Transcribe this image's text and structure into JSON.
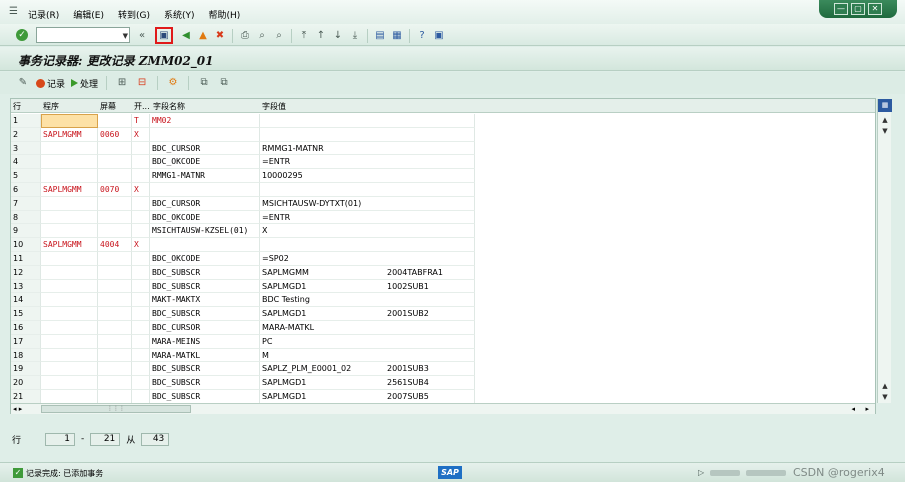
{
  "menu": {
    "items": [
      "记录(R)",
      "编辑(E)",
      "转到(G)",
      "系统(Y)",
      "帮助(H)"
    ]
  },
  "window_controls": [
    "—",
    "▢",
    "✕"
  ],
  "toolbar": {
    "command_field_value": "",
    "icons": [
      "enter-icon",
      "save-icon",
      "back-icon",
      "exit-icon",
      "cancel-icon",
      "print-icon",
      "find-icon",
      "find-next-icon",
      "first-page-icon",
      "prev-page-icon",
      "next-page-icon",
      "last-page-icon",
      "create-session-icon",
      "shortcut-icon",
      "help-icon",
      "layout-icon"
    ]
  },
  "title": "事务记录器: 更改记录 ZMM02_01",
  "app_toolbar": {
    "record_label": "记录",
    "process_label": "处理"
  },
  "table": {
    "headers": [
      "行",
      "程序",
      "屏幕",
      "开...",
      "字段名称",
      "字段值"
    ],
    "rows": [
      {
        "n": "1",
        "prog": "",
        "scr": "",
        "start": "T",
        "field": "MM02",
        "value": "",
        "extra": "",
        "field_red": true,
        "selected": true
      },
      {
        "n": "2",
        "prog": "SAPLMGMM",
        "scr": "0060",
        "start": "X",
        "field": "",
        "value": "",
        "extra": ""
      },
      {
        "n": "3",
        "prog": "",
        "scr": "",
        "start": "",
        "field": "BDC_CURSOR",
        "value": "RMMG1-MATNR",
        "extra": ""
      },
      {
        "n": "4",
        "prog": "",
        "scr": "",
        "start": "",
        "field": "BDC_OKCODE",
        "value": "=ENTR",
        "extra": ""
      },
      {
        "n": "5",
        "prog": "",
        "scr": "",
        "start": "",
        "field": "RMMG1-MATNR",
        "value": "10000295",
        "extra": ""
      },
      {
        "n": "6",
        "prog": "SAPLMGMM",
        "scr": "0070",
        "start": "X",
        "field": "",
        "value": "",
        "extra": ""
      },
      {
        "n": "7",
        "prog": "",
        "scr": "",
        "start": "",
        "field": "BDC_CURSOR",
        "value": "MSICHTAUSW-DYTXT(01)",
        "extra": ""
      },
      {
        "n": "8",
        "prog": "",
        "scr": "",
        "start": "",
        "field": "BDC_OKCODE",
        "value": "=ENTR",
        "extra": ""
      },
      {
        "n": "9",
        "prog": "",
        "scr": "",
        "start": "",
        "field": "MSICHTAUSW-KZSEL(01)",
        "value": "X",
        "extra": ""
      },
      {
        "n": "10",
        "prog": "SAPLMGMM",
        "scr": "4004",
        "start": "X",
        "field": "",
        "value": "",
        "extra": ""
      },
      {
        "n": "11",
        "prog": "",
        "scr": "",
        "start": "",
        "field": "BDC_OKCODE",
        "value": "=SP02",
        "extra": ""
      },
      {
        "n": "12",
        "prog": "",
        "scr": "",
        "start": "",
        "field": "BDC_SUBSCR",
        "value": "SAPLMGMM",
        "extra": "2004TABFRA1"
      },
      {
        "n": "13",
        "prog": "",
        "scr": "",
        "start": "",
        "field": "BDC_SUBSCR",
        "value": "SAPLMGD1",
        "extra": "1002SUB1"
      },
      {
        "n": "14",
        "prog": "",
        "scr": "",
        "start": "",
        "field": "MAKT-MAKTX",
        "value": "BDC Testing",
        "extra": ""
      },
      {
        "n": "15",
        "prog": "",
        "scr": "",
        "start": "",
        "field": "BDC_SUBSCR",
        "value": "SAPLMGD1",
        "extra": "2001SUB2"
      },
      {
        "n": "16",
        "prog": "",
        "scr": "",
        "start": "",
        "field": "BDC_CURSOR",
        "value": "MARA-MATKL",
        "extra": ""
      },
      {
        "n": "17",
        "prog": "",
        "scr": "",
        "start": "",
        "field": "MARA-MEINS",
        "value": "PC",
        "extra": ""
      },
      {
        "n": "18",
        "prog": "",
        "scr": "",
        "start": "",
        "field": "MARA-MATKL",
        "value": "M",
        "extra": ""
      },
      {
        "n": "19",
        "prog": "",
        "scr": "",
        "start": "",
        "field": "BDC_SUBSCR",
        "value": "SAPLZ_PLM_E0001_02",
        "extra": "2001SUB3"
      },
      {
        "n": "20",
        "prog": "",
        "scr": "",
        "start": "",
        "field": "BDC_SUBSCR",
        "value": "SAPLMGD1",
        "extra": "2561SUB4"
      },
      {
        "n": "21",
        "prog": "",
        "scr": "",
        "start": "",
        "field": "BDC_SUBSCR",
        "value": "SAPLMGD1",
        "extra": "2007SUB5"
      }
    ]
  },
  "pager": {
    "label": "行",
    "from": "1",
    "dash": "-",
    "to": "21",
    "of_label": "从",
    "total": "43"
  },
  "status": {
    "text": "记录完成: 已添加事务",
    "sap_logo": "SAP",
    "watermark": "CSDN @rogerix4"
  }
}
